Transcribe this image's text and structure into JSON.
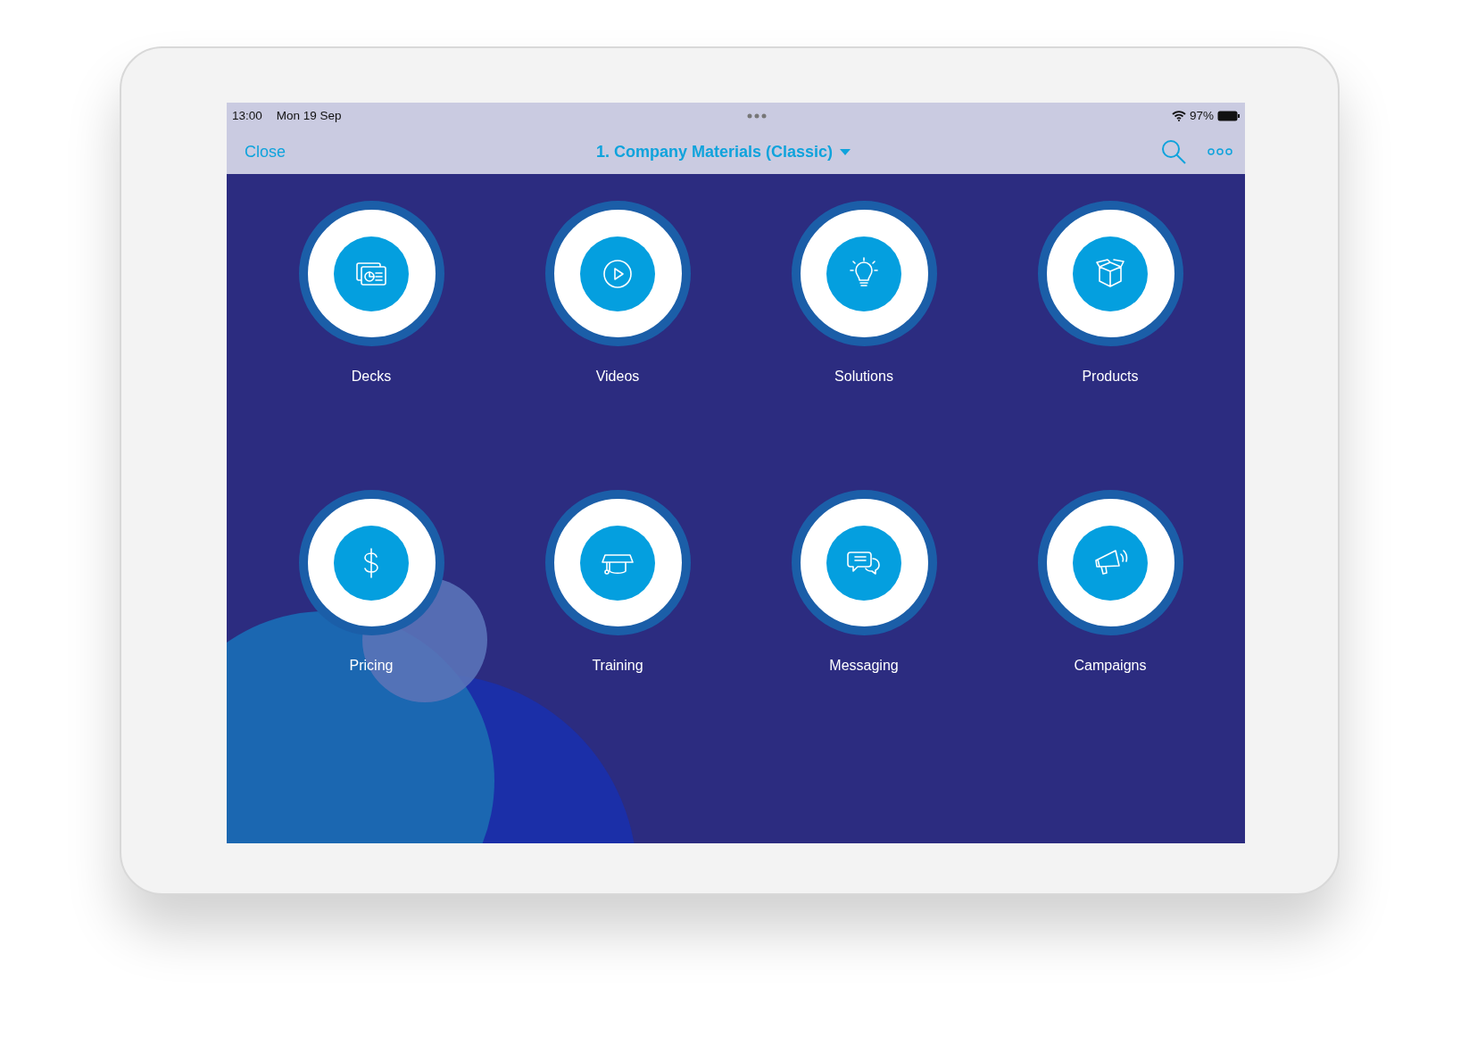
{
  "status_bar": {
    "time": "13:00",
    "date": "Mon 19 Sep",
    "battery": "97%"
  },
  "nav_bar": {
    "close": "Close",
    "title": "1. Company Materials (Classic)"
  },
  "tiles": [
    {
      "label": "Decks"
    },
    {
      "label": "Videos"
    },
    {
      "label": "Solutions"
    },
    {
      "label": "Products"
    },
    {
      "label": "Pricing"
    },
    {
      "label": "Training"
    },
    {
      "label": "Messaging"
    },
    {
      "label": "Campaigns"
    }
  ]
}
